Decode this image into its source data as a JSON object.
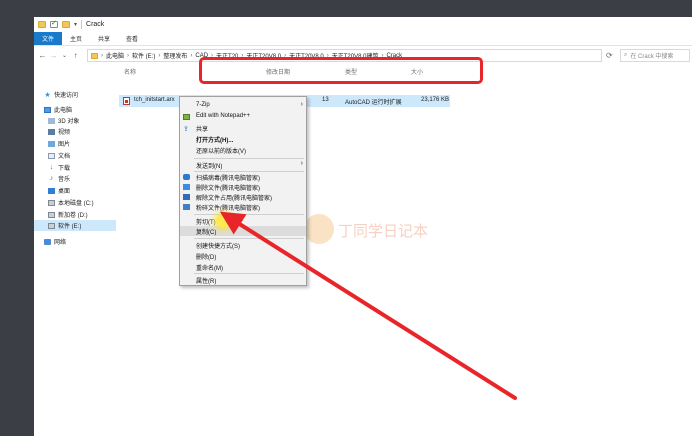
{
  "window": {
    "title": "Crack"
  },
  "ribbon": {
    "tabs": [
      "文件",
      "主页",
      "共享",
      "查看"
    ]
  },
  "address": {
    "crumbs": [
      "此电脑",
      "软件 (E:)",
      "整理发布",
      "CAD",
      "天正T20",
      "天正T20V8.0",
      "天正T20V8.0",
      "天正T20V8.0建筑",
      "Crack"
    ],
    "search_placeholder": "在 Crack 中搜索"
  },
  "sidebar": {
    "items": [
      {
        "label": "快速访问",
        "icon": "star-icon"
      },
      {
        "label": "此电脑",
        "icon": "computer-icon"
      },
      {
        "label": "3D 对象",
        "icon": "3d-objects-icon"
      },
      {
        "label": "视频",
        "icon": "video-icon"
      },
      {
        "label": "图片",
        "icon": "pictures-icon"
      },
      {
        "label": "文档",
        "icon": "documents-icon"
      },
      {
        "label": "下载",
        "icon": "download-icon"
      },
      {
        "label": "音乐",
        "icon": "music-icon"
      },
      {
        "label": "桌面",
        "icon": "desktop-icon"
      },
      {
        "label": "本地磁盘 (C:)",
        "icon": "drive-icon"
      },
      {
        "label": "新加卷 (D:)",
        "icon": "drive-icon"
      },
      {
        "label": "软件 (E:)",
        "icon": "drive-icon"
      },
      {
        "label": "网络",
        "icon": "network-icon"
      }
    ]
  },
  "columns": {
    "name": "名称",
    "date": "修改日期",
    "type": "类型",
    "size": "大小"
  },
  "file": {
    "name": "tch_initstart.arx",
    "date": "13",
    "type": "AutoCAD 运行时扩展",
    "size": "23,176 KB"
  },
  "context_menu": {
    "items": [
      {
        "label": "7-Zip",
        "has_submenu": true
      },
      {
        "label": "Edit with Notepad++"
      },
      {
        "label": "共享"
      },
      {
        "label": "打开方式(H)..."
      },
      {
        "label": "还原以前的版本(V)"
      },
      {
        "label": "发送到(N)",
        "has_submenu": true
      },
      {
        "label": "扫描病毒(腾讯电脑管家)"
      },
      {
        "label": "删除文件(腾讯电脑管家)"
      },
      {
        "label": "解除文件占用(腾讯电脑管家)"
      },
      {
        "label": "粉碎文件(腾讯电脑管家)"
      },
      {
        "label": "剪切(T)"
      },
      {
        "label": "复制(C)"
      },
      {
        "label": "创建快捷方式(S)"
      },
      {
        "label": "删除(D)"
      },
      {
        "label": "重命名(M)"
      },
      {
        "label": "属性(R)"
      }
    ]
  },
  "watermark": {
    "text": "丁同学日记本"
  },
  "colors": {
    "accent": "#1979ca",
    "highlight": "#e8262a",
    "selection": "#cde8fb"
  }
}
